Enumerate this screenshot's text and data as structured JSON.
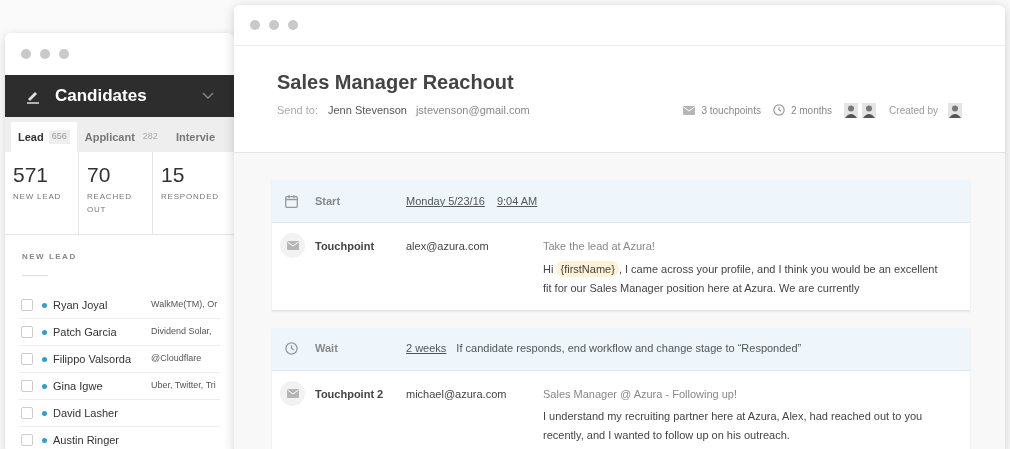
{
  "back_window": {
    "title": "Candidates",
    "tabs": [
      {
        "label": "Lead",
        "count": "656",
        "selected": true
      },
      {
        "label": "Applicant",
        "count": "282",
        "selected": false
      },
      {
        "label": "Intervie",
        "selected": false
      }
    ],
    "stats": [
      {
        "value": "571",
        "label": "NEW LEAD"
      },
      {
        "value": "70",
        "label": "REACHED OUT"
      },
      {
        "value": "15",
        "label": "RESPONDED"
      }
    ],
    "list_heading": "NEW LEAD",
    "rows": [
      {
        "name": "Ryan Joyal",
        "company": "WalkMe(TM), Or",
        "checked": false
      },
      {
        "name": "Patch Garcia",
        "company": "Dividend Solar,",
        "checked": false
      },
      {
        "name": "Filippo Valsorda",
        "company": "@Cloudflare",
        "checked": false
      },
      {
        "name": "Gina Igwe",
        "company": "Uber, Twitter, Tri",
        "checked": false
      },
      {
        "name": "David Lasher",
        "checked": false
      },
      {
        "name": "Austin Ringer",
        "checked": false
      }
    ]
  },
  "front_window": {
    "title": "Sales Manager Reachout",
    "send_to_label": "Send to:",
    "recipient_name": "Jenn Stevenson",
    "recipient_email": "jstevenson@gmail.com",
    "touchpoints": "3 touchpoints",
    "duration": "2 months",
    "created_by": "Created by",
    "groups": [
      [
        {
          "kind": "start",
          "label": "Start",
          "date": "Monday 5/23/16",
          "time": "9:04 AM"
        },
        {
          "kind": "touchpoint",
          "label": "Touchpoint",
          "email": "alex@azura.com",
          "subject": "Take the lead at Azura!",
          "body_before": "Hi",
          "token": "{firstName}",
          "body_after": ", I came across your profile, and I think you would be an excellent fit for our Sales Manager position here at Azura. We are currently"
        }
      ],
      [
        {
          "kind": "wait",
          "label": "Wait",
          "period": "2 weeks",
          "note": "If candidate responds, end workflow and change stage to “Responded”"
        },
        {
          "kind": "touchpoint",
          "label": "Touchpoint 2",
          "email": "michael@azura.com",
          "subject": "Sales Manager @ Azura - Following up!",
          "body_before": "I understand my recruiting partner here at Azura, Alex, had reached out to you recently, and I wanted to follow up on his outreach."
        }
      ]
    ]
  }
}
